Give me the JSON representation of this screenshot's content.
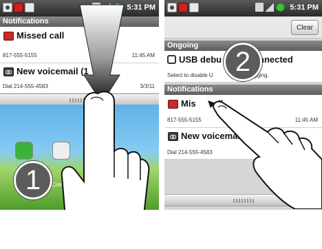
{
  "left_panel": {
    "status_bar": {
      "time": "5:31 PM"
    },
    "header": "Notifications",
    "notifications": [
      {
        "title": "Missed call",
        "subtitle": "817-555-5155",
        "time": "11:45 AM",
        "icon": "missed-call-icon"
      },
      {
        "title": "New voicemail (1",
        "subtitle": "Dial 214-555-4583",
        "time": "3/3/11",
        "icon": "voicemail-icon"
      }
    ],
    "home_label": "Contacts",
    "step_number": "1"
  },
  "right_panel": {
    "status_bar": {
      "time": "5:31 PM"
    },
    "clear_button": "Clear",
    "ongoing_header": "Ongoing",
    "ongoing": {
      "title": "USB debu",
      "title_tail": "nnected",
      "subtitle": "Select to disable U",
      "subtitle_tail": "gging."
    },
    "notifications_header": "Notifications",
    "notifications": [
      {
        "title": "Mis",
        "title_tail": "ll",
        "subtitle": "817-555-5155",
        "time": "11:45 AM",
        "icon": "missed-call-icon"
      },
      {
        "title": "New voicemail (1)",
        "subtitle": "Dial 214-555-4583",
        "time": "",
        "icon": "voicemail-icon"
      }
    ],
    "step_number": "2"
  },
  "colors": {
    "section_header": "#6e6e6e",
    "status_bar": "#3a3a3a",
    "badge": "#5c5c5c",
    "missed_call": "#c62a2a"
  }
}
